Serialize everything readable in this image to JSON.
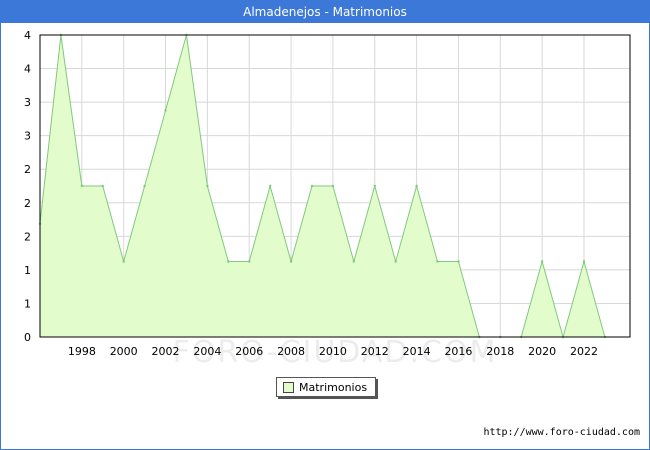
{
  "window": {
    "title": "Almadenejos - Matrimonios"
  },
  "source_url": "http://www.foro-ciudad.com",
  "watermark": "FORO-CIUDAD.COM",
  "colors": {
    "titlebar": "#3c78d8",
    "fill": "#e3fccc",
    "line": "#80c880",
    "grid": "#d8d8d8"
  },
  "chart_data": {
    "type": "area",
    "title": "Almadenejos - Matrimonios",
    "xlabel": "",
    "ylabel": "",
    "x": [
      1996,
      1997,
      1998,
      1999,
      2000,
      2001,
      2002,
      2003,
      2004,
      2005,
      2006,
      2007,
      2008,
      2009,
      2010,
      2011,
      2012,
      2013,
      2014,
      2015,
      2016,
      2017,
      2018,
      2019,
      2020,
      2021,
      2022,
      2023
    ],
    "series": [
      {
        "name": "Matrimonios",
        "values": [
          1.5,
          4,
          2,
          2,
          1,
          2,
          3,
          4,
          2,
          1,
          1,
          2,
          1,
          2,
          2,
          1,
          2,
          1,
          2,
          1,
          1,
          0,
          0,
          0,
          1,
          0,
          1,
          0
        ]
      }
    ],
    "xlim": [
      1996,
      2024.2
    ],
    "ylim": [
      0,
      4
    ],
    "x_ticks": [
      "1998",
      "2000",
      "2002",
      "2004",
      "2006",
      "2008",
      "2010",
      "2012",
      "2014",
      "2016",
      "2018",
      "2020",
      "2022"
    ],
    "y_ticks": [
      "0",
      "1",
      "1",
      "2",
      "2",
      "2",
      "3",
      "3",
      "4",
      "4"
    ],
    "grid": true,
    "legend": {
      "position": "bottom-center",
      "entries": [
        "Matrimonios"
      ]
    }
  }
}
